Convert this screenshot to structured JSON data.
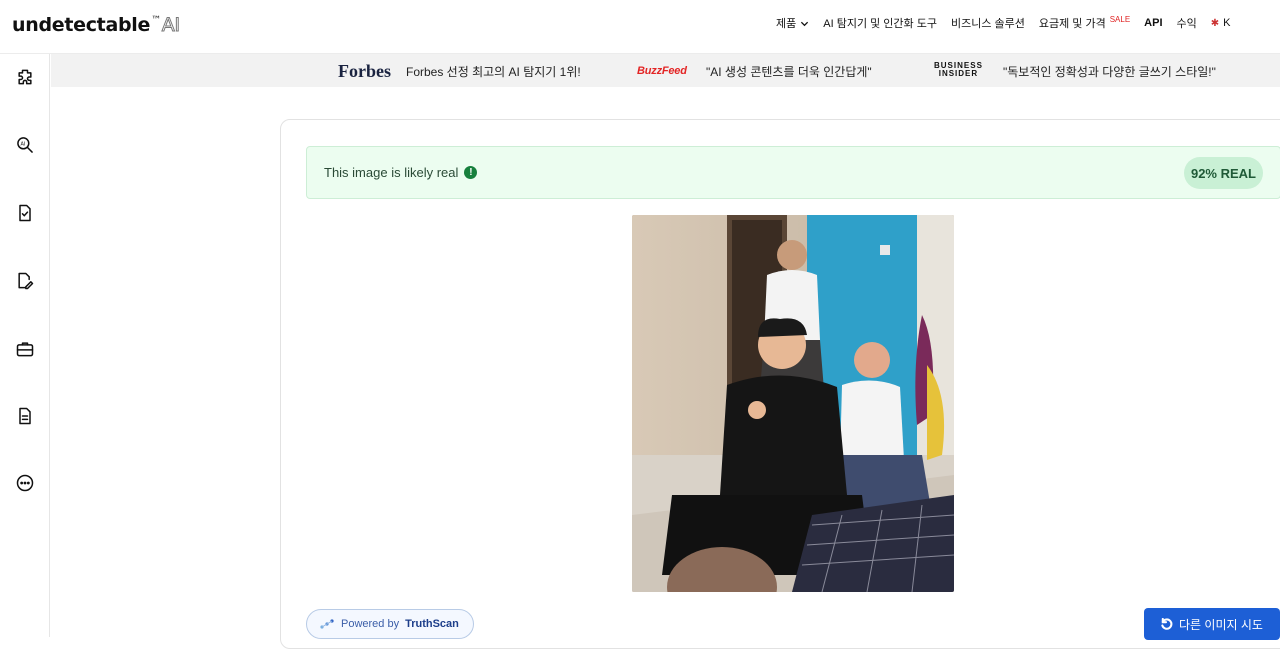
{
  "header": {
    "logo_main": "undetectable",
    "logo_tm": "™",
    "logo_suffix": "AI",
    "nav": {
      "products": "제품",
      "ai_detector": "AI 탐지기 및 인간화 도구",
      "business": "비즈니스 솔루션",
      "pricing": "요금제 및 가격",
      "sale_badge": "SALE",
      "api": "API",
      "earnings": "수익",
      "language": "K"
    }
  },
  "sidebar": {
    "icons": [
      "puzzle-icon",
      "ai-search-icon",
      "document-check-icon",
      "document-edit-icon",
      "briefcase-icon",
      "document-text-icon",
      "more-icon"
    ]
  },
  "press": {
    "forbes_logo": "Forbes",
    "forbes_quote": "Forbes 선정 최고의 AI 탐지기 1위!",
    "buzzfeed_logo": "BuzzFeed",
    "buzzfeed_quote": "\"AI 생성 콘텐츠를 더욱 인간답게\"",
    "bi_logo_line1": "BUSINESS",
    "bi_logo_line2": "INSIDER",
    "bi_quote": "\"독보적인 정확성과 다양한 글쓰기 스타일!\""
  },
  "result": {
    "label": "This image is likely real",
    "info_glyph": "!",
    "score": "92% REAL",
    "status_color": "#17803d"
  },
  "footer": {
    "powered_prefix": "Powered by",
    "powered_brand": "TruthScan",
    "retry_button": "다른 이미지 시도"
  },
  "colors": {
    "accent": "#1d5fd6",
    "result_bg": "#ecfdf0"
  }
}
